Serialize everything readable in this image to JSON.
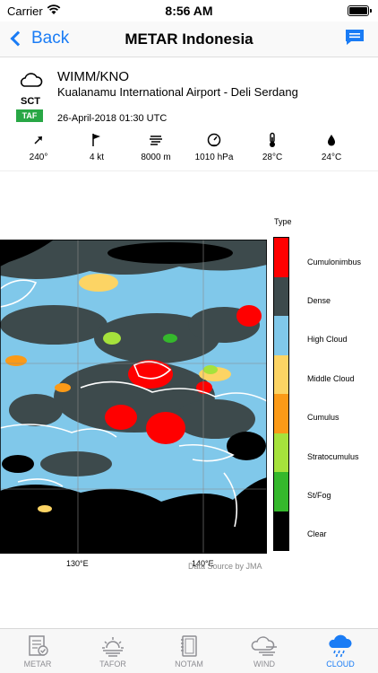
{
  "status": {
    "carrier": "Carrier",
    "time": "8:56 AM"
  },
  "nav": {
    "back_label": "Back",
    "title": "METAR Indonesia",
    "message_icon": "message-icon"
  },
  "station": {
    "cloud_code": "SCT",
    "badge": "TAF",
    "code": "WIMM/KNO",
    "name": "Kualanamu International Airport - Deli Serdang",
    "date": "26-April-2018 01:30 UTC"
  },
  "metrics": [
    {
      "icon": "wind-direction-icon",
      "value": "240°"
    },
    {
      "icon": "wind-speed-flag-icon",
      "value": "4 kt"
    },
    {
      "icon": "visibility-icon",
      "value": "8000 m"
    },
    {
      "icon": "pressure-gauge-icon",
      "value": "1010 hPa"
    },
    {
      "icon": "thermometer-icon",
      "value": "28°C"
    },
    {
      "icon": "dewpoint-drop-icon",
      "value": "24°C"
    }
  ],
  "map": {
    "legend_title": "Type",
    "legend": [
      {
        "label": "Cumulonimbus",
        "color": "#ff0000"
      },
      {
        "label": "Dense",
        "color": "#3d4a4c"
      },
      {
        "label": "High Cloud",
        "color": "#80c8ea"
      },
      {
        "label": "Middle Cloud",
        "color": "#fcd464"
      },
      {
        "label": "Cumulus",
        "color": "#fb9a17"
      },
      {
        "label": "Stratocumulus",
        "color": "#a6e23c"
      },
      {
        "label": "St/Fog",
        "color": "#35b82c"
      },
      {
        "label": "Clear",
        "color": "#000000"
      }
    ],
    "x_ticks": [
      "130°E",
      "140°E"
    ],
    "credit": "Data Source by JMA"
  },
  "tabs": [
    {
      "label": "METAR",
      "icon": "metar-report-icon",
      "active": false
    },
    {
      "label": "TAFOR",
      "icon": "tafor-sun-icon",
      "active": false
    },
    {
      "label": "NOTAM",
      "icon": "notam-notebook-icon",
      "active": false
    },
    {
      "label": "WIND",
      "icon": "wind-cloud-icon",
      "active": false
    },
    {
      "label": "CLOUD",
      "icon": "cloud-rain-icon",
      "active": true
    }
  ],
  "colors": {
    "accent": "#1a7cf5",
    "taf_badge": "#28a745"
  }
}
